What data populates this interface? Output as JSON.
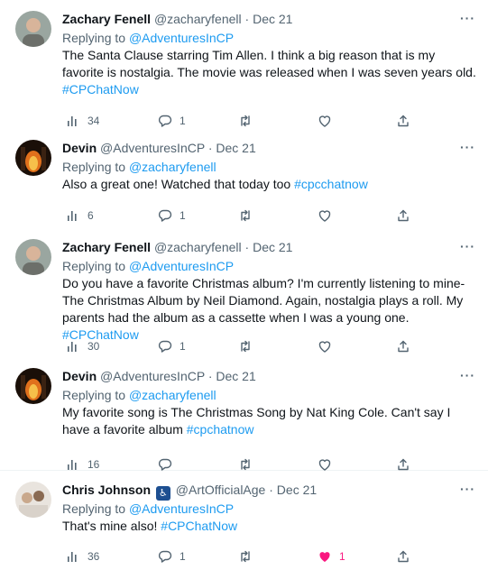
{
  "separator": "·",
  "colors": {
    "link": "#1d9bf0",
    "muted": "#536471",
    "like": "#f91880"
  },
  "tweets": [
    {
      "name": "Zachary Fenell",
      "handle": "@zacharyfenell",
      "date": "Dec 21",
      "replying_prefix": "Replying to",
      "replying_to": "@AdventuresInCP",
      "text": "The Santa Clause starring Tim Allen. I think a big reason that is my favorite is nostalgia. The movie was released when I was seven years old.",
      "hashtag": "#CPChatNow",
      "views": "34",
      "replies": "1",
      "retweets": "",
      "likes": ""
    },
    {
      "name": "Devin",
      "handle": "@AdventuresInCP",
      "date": "Dec 21",
      "replying_prefix": "Replying to",
      "replying_to": "@zacharyfenell",
      "text": "Also a great one! Watched that today too",
      "hashtag": "#cpcchatnow",
      "views": "6",
      "replies": "1",
      "retweets": "",
      "likes": ""
    },
    {
      "name": "Zachary Fenell",
      "handle": "@zacharyfenell",
      "date": "Dec 21",
      "replying_prefix": "Replying to",
      "replying_to": "@AdventuresInCP",
      "text": "Do you have a favorite Christmas album? I'm currently listening to mine- The Christmas Album by Neil Diamond. Again, nostalgia plays a roll. My parents had the album as a cassette when I was a young one.",
      "hashtag": "#CPChatNow",
      "views": "30",
      "replies": "1",
      "retweets": "",
      "likes": ""
    },
    {
      "name": "Devin",
      "handle": "@AdventuresInCP",
      "date": "Dec 21",
      "replying_prefix": "Replying to",
      "replying_to": "@zacharyfenell",
      "text": "My favorite song is The Christmas Song by Nat King Cole. Can't say I have a favorite album",
      "hashtag": "#cpchatnow",
      "views": "16",
      "replies": "",
      "retweets": "",
      "likes": ""
    },
    {
      "name": "Chris Johnson",
      "badge_icon": "accessibility-icon",
      "handle": "@ArtOfficialAge",
      "date": "Dec 21",
      "replying_prefix": "Replying to",
      "replying_to": "@AdventuresInCP",
      "text": "That's mine also!",
      "hashtag": "#CPChatNow",
      "views": "36",
      "replies": "1",
      "retweets": "",
      "likes": "1",
      "liked": true
    }
  ]
}
